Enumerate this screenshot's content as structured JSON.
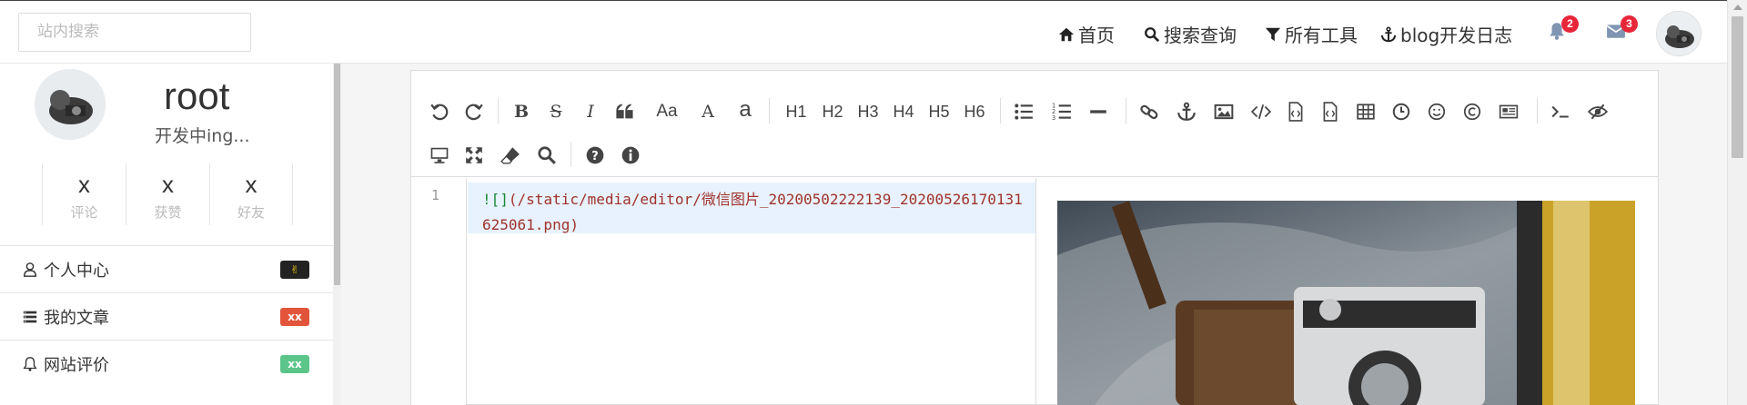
{
  "nav": {
    "search_placeholder": "站内搜索",
    "home": "首页",
    "search_query": "搜索查询",
    "all_tools": "所有工具",
    "dev_log": "blog开发日志",
    "notification_count": "2",
    "message_count": "3"
  },
  "profile": {
    "username": "root",
    "motto": "开发中ing...",
    "stats": [
      {
        "value": "x",
        "label": "评论"
      },
      {
        "value": "x",
        "label": "获赞"
      },
      {
        "value": "x",
        "label": "好友"
      }
    ]
  },
  "menu": [
    {
      "label": "个人中心",
      "icon": "user-icon",
      "badge": "✌"
    },
    {
      "label": "我的文章",
      "icon": "list-icon",
      "badge": "xx"
    },
    {
      "label": "网站评价",
      "icon": "bell-icon",
      "badge": "xx"
    }
  ],
  "toolbar": {
    "case_upper": "Aa",
    "font_large": "A",
    "font_small": "a",
    "h1": "H1",
    "h2": "H2",
    "h3": "H3",
    "h4": "H4",
    "h5": "H5",
    "h6": "H6"
  },
  "editor": {
    "line_number": "1",
    "code_prefix": "![]",
    "code_path": "(/static/media/editor/微信图片_20200502222139_20200526170131625061.png)"
  },
  "colors": {
    "badge_red": "#e8263a",
    "menu_badge_red": "#e2553a",
    "menu_badge_green": "#5cc58a",
    "code_highlight": "#e8f2fe"
  }
}
